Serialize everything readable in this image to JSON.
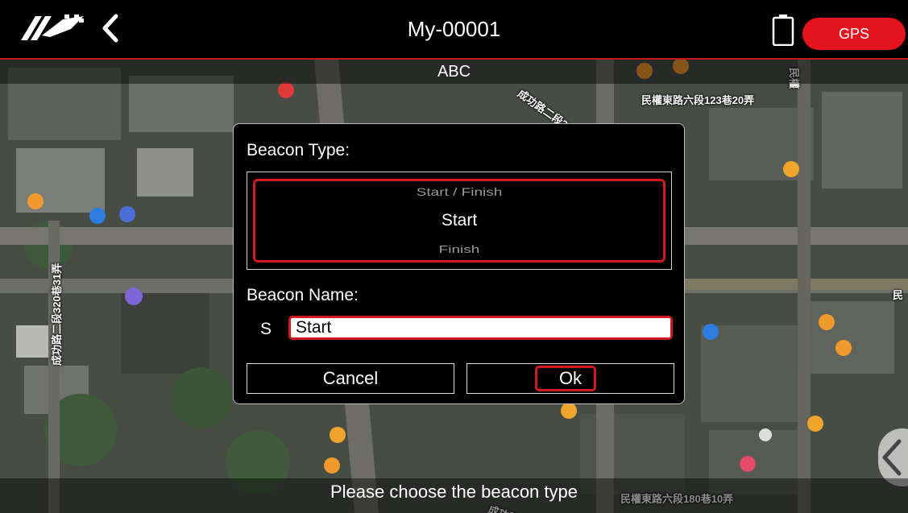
{
  "header": {
    "title": "My-00001",
    "gps_label": "GPS",
    "accent_color": "#e3141d"
  },
  "map": {
    "subtitle": "ABC",
    "street_labels": [
      "民權東路六段123巷20弄",
      "民權東路六段180巷10弄",
      "成功路二段320巷31弄",
      "成功路二段317",
      "成功路",
      "民權",
      "民"
    ]
  },
  "dialog": {
    "beacon_type_label": "Beacon Type:",
    "picker_options": [
      "Start / Finish",
      "Start",
      "Finish"
    ],
    "selected_option": "Start",
    "beacon_name_label": "Beacon Name:",
    "name_prefix": "S",
    "name_value": "Start",
    "cancel_label": "Cancel",
    "ok_label": "Ok"
  },
  "status": {
    "message": "Please choose the beacon type"
  },
  "icons": [
    "logo-icon",
    "back-chevron-icon",
    "battery-icon",
    "side-handle-chevron-icon"
  ]
}
